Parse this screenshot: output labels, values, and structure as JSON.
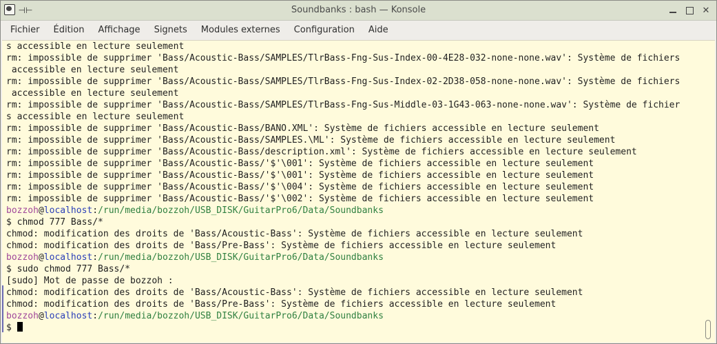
{
  "window": {
    "title": "Soundbanks : bash — Konsole",
    "controls": {
      "minimize": "minimize",
      "maximize": "maximize",
      "close": "✕"
    }
  },
  "menubar": {
    "items": [
      "Fichier",
      "Édition",
      "Affichage",
      "Signets",
      "Modules externes",
      "Configuration",
      "Aide"
    ]
  },
  "terminal": {
    "lines": [
      {
        "type": "text",
        "text": "s accessible en lecture seulement"
      },
      {
        "type": "text",
        "text": "rm: impossible de supprimer 'Bass/Acoustic-Bass/SAMPLES/TlrBass-Fng-Sus-Index-00-4E28-032-none-none.wav': Système de fichiers"
      },
      {
        "type": "text",
        "text": " accessible en lecture seulement"
      },
      {
        "type": "text",
        "text": "rm: impossible de supprimer 'Bass/Acoustic-Bass/SAMPLES/TlrBass-Fng-Sus-Index-02-2D38-058-none-none.wav': Système de fichiers"
      },
      {
        "type": "text",
        "text": " accessible en lecture seulement"
      },
      {
        "type": "text",
        "text": "rm: impossible de supprimer 'Bass/Acoustic-Bass/SAMPLES/TlrBass-Fng-Sus-Middle-03-1G43-063-none-none.wav': Système de fichier"
      },
      {
        "type": "text",
        "text": "s accessible en lecture seulement"
      },
      {
        "type": "text",
        "text": "rm: impossible de supprimer 'Bass/Acoustic-Bass/BANO.XML': Système de fichiers accessible en lecture seulement"
      },
      {
        "type": "text",
        "text": "rm: impossible de supprimer 'Bass/Acoustic-Bass/SAMPLES.\\ML': Système de fichiers accessible en lecture seulement"
      },
      {
        "type": "text",
        "text": "rm: impossible de supprimer 'Bass/Acoustic-Bass/description.xml': Système de fichiers accessible en lecture seulement"
      },
      {
        "type": "text",
        "text": "rm: impossible de supprimer 'Bass/Acoustic-Bass/'$'\\001': Système de fichiers accessible en lecture seulement"
      },
      {
        "type": "text",
        "text": "rm: impossible de supprimer 'Bass/Acoustic-Bass/'$'\\001': Système de fichiers accessible en lecture seulement"
      },
      {
        "type": "text",
        "text": "rm: impossible de supprimer 'Bass/Acoustic-Bass/'$'\\004': Système de fichiers accessible en lecture seulement"
      },
      {
        "type": "text",
        "text": "rm: impossible de supprimer 'Bass/Acoustic-Bass/'$'\\002': Système de fichiers accessible en lecture seulement"
      },
      {
        "type": "prompt",
        "user": "bozzoh",
        "at": "@",
        "host": "localhost",
        "sep": ":",
        "path": "/run/media/bozzoh/USB_DISK/GuitarPro6/Data/Soundbanks"
      },
      {
        "type": "text",
        "text": "$ chmod 777 Bass/*"
      },
      {
        "type": "text",
        "text": "chmod: modification des droits de 'Bass/Acoustic-Bass': Système de fichiers accessible en lecture seulement"
      },
      {
        "type": "text",
        "text": "chmod: modification des droits de 'Bass/Pre-Bass': Système de fichiers accessible en lecture seulement"
      },
      {
        "type": "prompt",
        "user": "bozzoh",
        "at": "@",
        "host": "localhost",
        "sep": ":",
        "path": "/run/media/bozzoh/USB_DISK/GuitarPro6/Data/Soundbanks"
      },
      {
        "type": "text",
        "text": "$ sudo chmod 777 Bass/*"
      },
      {
        "type": "text",
        "text": "[sudo] Mot de passe de bozzoh :"
      },
      {
        "type": "text",
        "text": "chmod: modification des droits de 'Bass/Acoustic-Bass': Système de fichiers accessible en lecture seulement"
      },
      {
        "type": "text",
        "text": "chmod: modification des droits de 'Bass/Pre-Bass': Système de fichiers accessible en lecture seulement"
      },
      {
        "type": "prompt",
        "user": "bozzoh",
        "at": "@",
        "host": "localhost",
        "sep": ":",
        "path": "/run/media/bozzoh/USB_DISK/GuitarPro6/Data/Soundbanks"
      },
      {
        "type": "input",
        "text": "$ "
      }
    ]
  },
  "colors": {
    "terminal_bg": "#fffbdc",
    "user": "#a0489a",
    "host": "#2a3fb8",
    "path": "#2f8040"
  },
  "icons": [
    "konsole-app-icon",
    "pin-icon",
    "minimize-icon",
    "maximize-icon",
    "close-icon",
    "scrollbar-thumb"
  ]
}
